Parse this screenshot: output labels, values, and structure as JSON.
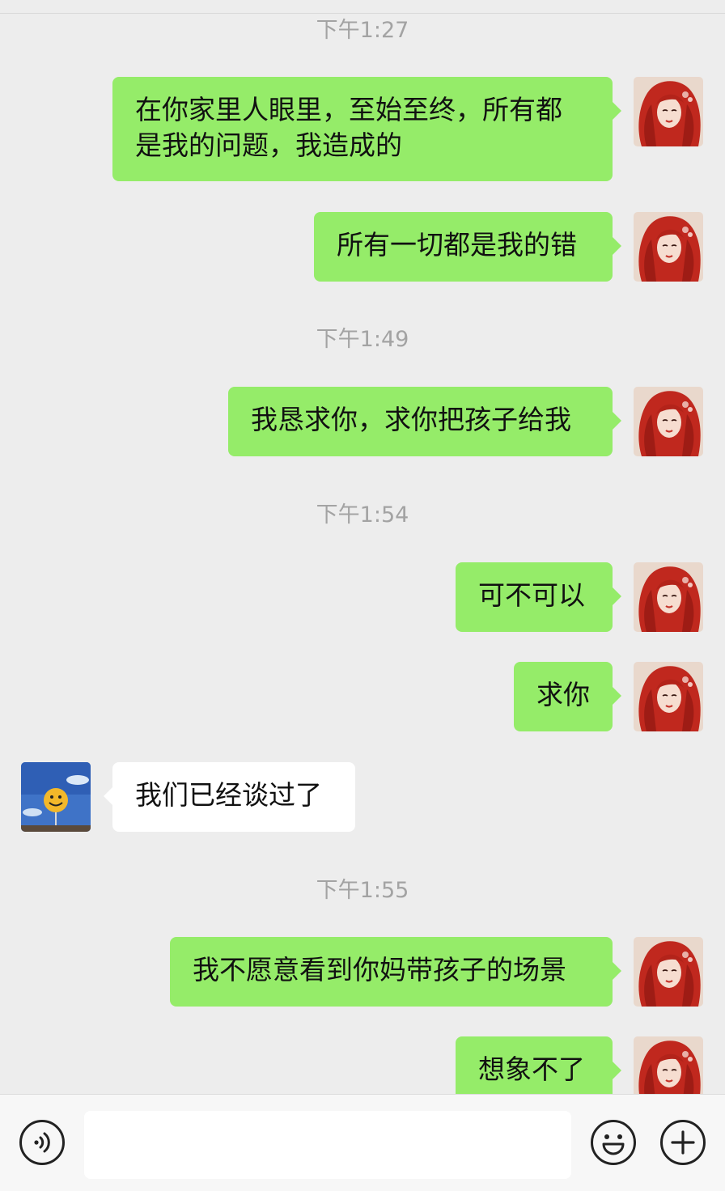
{
  "colors": {
    "outgoing": "#95ec69",
    "incoming": "#ffffff",
    "background": "#ededed",
    "timestamp": "#a3a3a3"
  },
  "timestamps": [
    "下午1:27",
    "下午1:49",
    "下午1:54",
    "下午1:55"
  ],
  "messages": [
    {
      "side": "me",
      "text": "在你家里人眼里，至始至终，所有都\n是我的问题，我造成的"
    },
    {
      "side": "me",
      "text": "所有一切都是我的错"
    },
    {
      "side": "me",
      "text": "我恳求你，求你把孩子给我"
    },
    {
      "side": "me",
      "text": "可不可以"
    },
    {
      "side": "me",
      "text": "求你"
    },
    {
      "side": "them",
      "text": "我们已经谈过了"
    },
    {
      "side": "me",
      "text": "我不愿意看到你妈带孩子的场景"
    },
    {
      "side": "me",
      "text": "想象不了"
    }
  ],
  "input": {
    "value": "",
    "placeholder": ""
  },
  "icons": {
    "voice": "voice-icon",
    "emoji": "emoji-icon",
    "add": "plus-icon"
  }
}
